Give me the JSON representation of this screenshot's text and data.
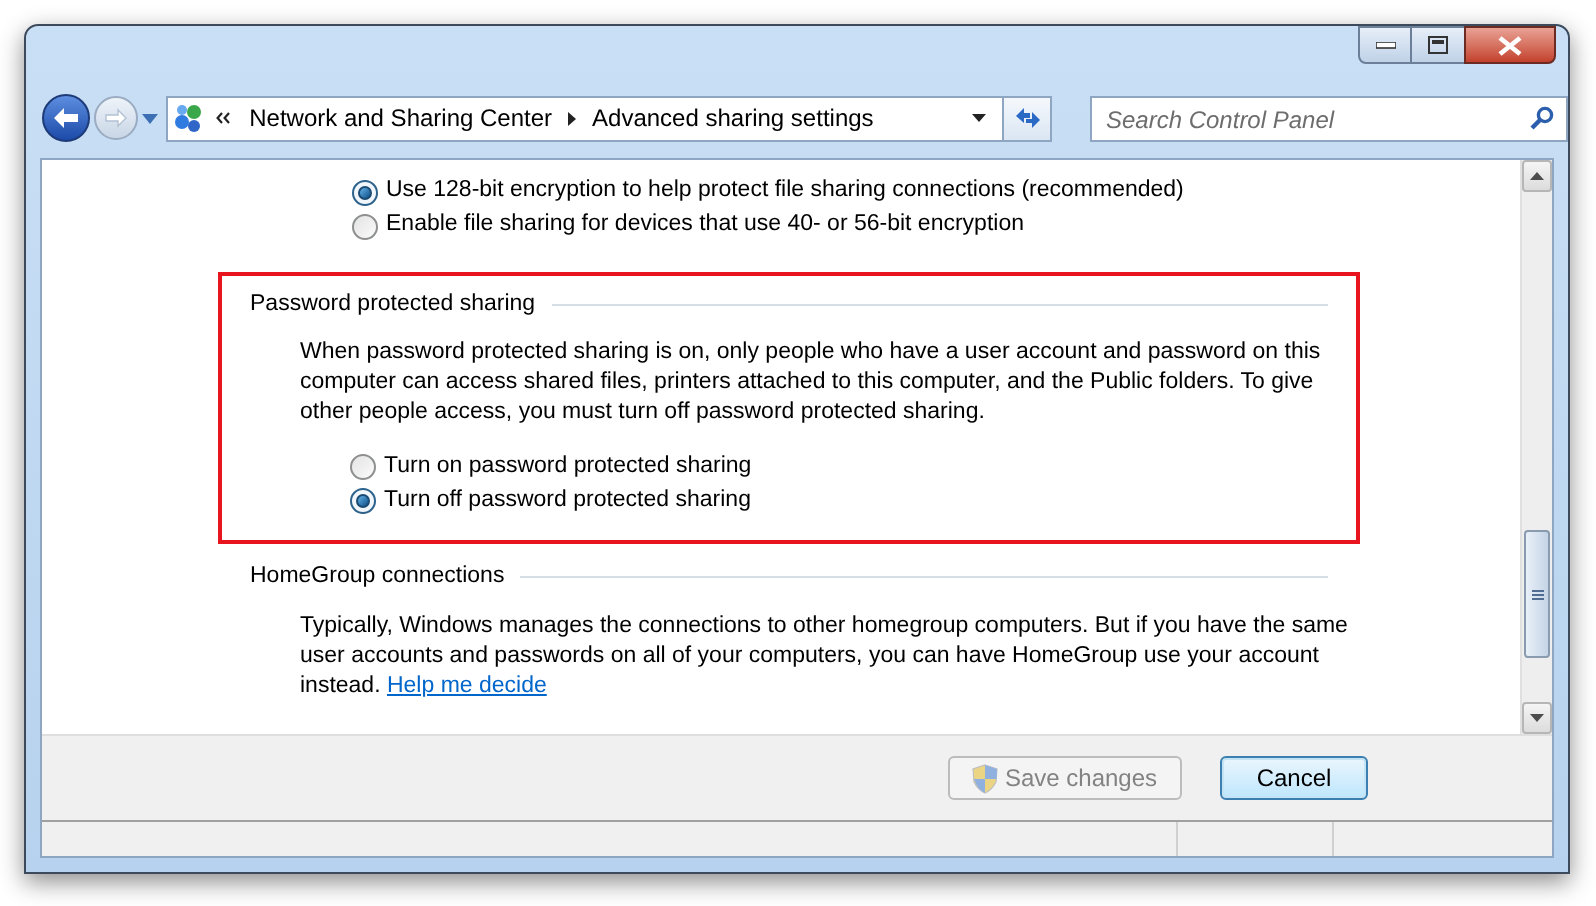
{
  "navigation": {
    "breadcrumb": [
      {
        "label": "Network and Sharing Center"
      },
      {
        "label": "Advanced sharing settings"
      }
    ],
    "search": {
      "placeholder": "Search Control Panel"
    }
  },
  "content": {
    "encryption_options": [
      {
        "label": "Use 128-bit encryption to help protect file sharing connections (recommended)",
        "selected": true
      },
      {
        "label": "Enable file sharing for devices that use 40- or 56-bit encryption",
        "selected": false
      }
    ],
    "sections": [
      {
        "title": "Password protected sharing",
        "highlighted": true,
        "description": "When password protected sharing is on, only people who have a user account and password on this computer can access shared files, printers attached to this computer, and the Public folders. To give other people access, you must turn off password protected sharing.",
        "options": [
          {
            "label": "Turn on password protected sharing",
            "selected": false
          },
          {
            "label": "Turn off password protected sharing",
            "selected": true
          }
        ]
      },
      {
        "title": "HomeGroup connections",
        "highlighted": false,
        "description": "Typically, Windows manages the connections to other homegroup computers. But if you have the same user accounts and passwords on all of your computers, you can have HomeGroup use your account instead.",
        "link": "Help me decide"
      }
    ]
  },
  "buttons": [
    {
      "label": "Save changes",
      "disabled": true,
      "kind": "shield"
    },
    {
      "label": "Cancel",
      "disabled": false,
      "kind": "plain"
    }
  ]
}
